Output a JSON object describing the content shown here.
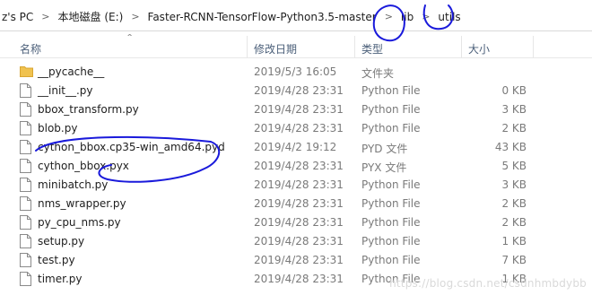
{
  "breadcrumb": {
    "items": [
      "z's PC",
      "本地磁盘 (E:)",
      "Faster-RCNN-TensorFlow-Python3.5-master",
      "lib",
      "utils"
    ]
  },
  "columns": {
    "name": "名称",
    "date": "修改日期",
    "type": "类型",
    "size": "大小"
  },
  "files": [
    {
      "name": "__pycache__",
      "date": "2019/5/3 16:05",
      "type": "文件夹",
      "size": "",
      "icon": "folder-icon"
    },
    {
      "name": "__init__.py",
      "date": "2019/4/28 23:31",
      "type": "Python File",
      "size": "0 KB",
      "icon": "file-icon"
    },
    {
      "name": "bbox_transform.py",
      "date": "2019/4/28 23:31",
      "type": "Python File",
      "size": "3 KB",
      "icon": "file-icon"
    },
    {
      "name": "blob.py",
      "date": "2019/4/28 23:31",
      "type": "Python File",
      "size": "2 KB",
      "icon": "file-icon"
    },
    {
      "name": "cython_bbox.cp35-win_amd64.pyd",
      "date": "2019/4/2 19:12",
      "type": "PYD 文件",
      "size": "43 KB",
      "icon": "file-icon"
    },
    {
      "name": "cython_bbox.pyx",
      "date": "2019/4/28 23:31",
      "type": "PYX 文件",
      "size": "5 KB",
      "icon": "file-icon"
    },
    {
      "name": "minibatch.py",
      "date": "2019/4/28 23:31",
      "type": "Python File",
      "size": "3 KB",
      "icon": "file-icon"
    },
    {
      "name": "nms_wrapper.py",
      "date": "2019/4/28 23:31",
      "type": "Python File",
      "size": "2 KB",
      "icon": "file-icon"
    },
    {
      "name": "py_cpu_nms.py",
      "date": "2019/4/28 23:31",
      "type": "Python File",
      "size": "2 KB",
      "icon": "file-icon"
    },
    {
      "name": "setup.py",
      "date": "2019/4/28 23:31",
      "type": "Python File",
      "size": "1 KB",
      "icon": "file-icon"
    },
    {
      "name": "test.py",
      "date": "2019/4/28 23:31",
      "type": "Python File",
      "size": "7 KB",
      "icon": "file-icon"
    },
    {
      "name": "timer.py",
      "date": "2019/4/28 23:31",
      "type": "Python File",
      "size": "1 KB",
      "icon": "file-icon"
    }
  ],
  "watermark": "https://blog.csdn.net/csdnhmbdybb",
  "colors": {
    "annotation_ink": "#1a1adb",
    "folder": "#f0c24f",
    "header_text": "#4c607a"
  }
}
